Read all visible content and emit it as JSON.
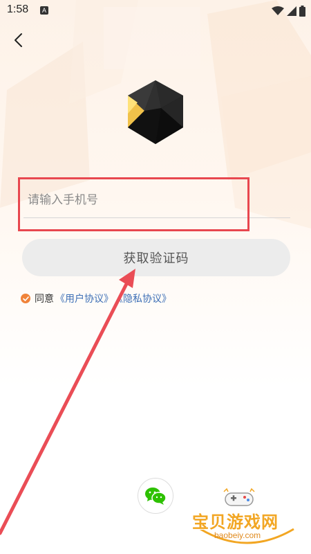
{
  "status_bar": {
    "time": "1:58",
    "app_icon_letter": "A"
  },
  "login": {
    "phone_placeholder": "请输入手机号",
    "phone_value": "",
    "get_code_label": "获取验证码",
    "agree_prefix": "同意",
    "user_agreement": "《用户协议》",
    "privacy_agreement": "《隐私协议》"
  },
  "watermark": {
    "title": "宝贝游戏网",
    "url": "baobeiy.com"
  },
  "colors": {
    "highlight": "#e8474f",
    "link": "#3d6fb6",
    "check": "#f0833a",
    "wechat": "#2dc100",
    "button_bg": "#ececec"
  },
  "icons": {
    "back": "chevron-left-icon",
    "logo": "dark-icosahedron-logo",
    "wechat": "wechat-icon",
    "wifi": "wifi-icon",
    "signal": "signal-icon",
    "battery": "battery-icon"
  }
}
